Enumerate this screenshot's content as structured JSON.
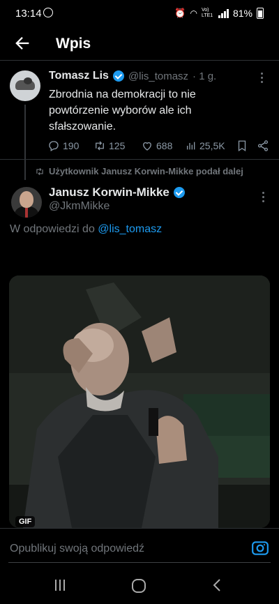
{
  "status_bar": {
    "time": "13:14",
    "network": "Vo) LTE1",
    "battery": "81%"
  },
  "header": {
    "back_icon": "arrow-left-icon",
    "title": "Wpis"
  },
  "tweet": {
    "author_name": "Tomasz Lis",
    "author_handle": "@lis_tomasz",
    "time_ago": "· 1 g.",
    "text": "Zbrodnia na demokracji to nie powtórzenie wyborów ale ich sfałszowanie.",
    "replies": "190",
    "retweets": "125",
    "likes": "688",
    "views": "25,5K"
  },
  "retweet_label": "Użytkownik Janusz Korwin-Mikke podał dalej",
  "reply": {
    "author_name": "Janusz Korwin-Mikke",
    "author_handle": "@JkmMikke",
    "reply_prefix": "W odpowiedzi do ",
    "reply_to_handle": "@lis_tomasz",
    "media_badge": "GIF"
  },
  "composer": {
    "placeholder": "Opublikuj swoją odpowiedź"
  },
  "colors": {
    "background": "#000000",
    "accent": "#1d9bf0",
    "muted": "#71767b"
  }
}
